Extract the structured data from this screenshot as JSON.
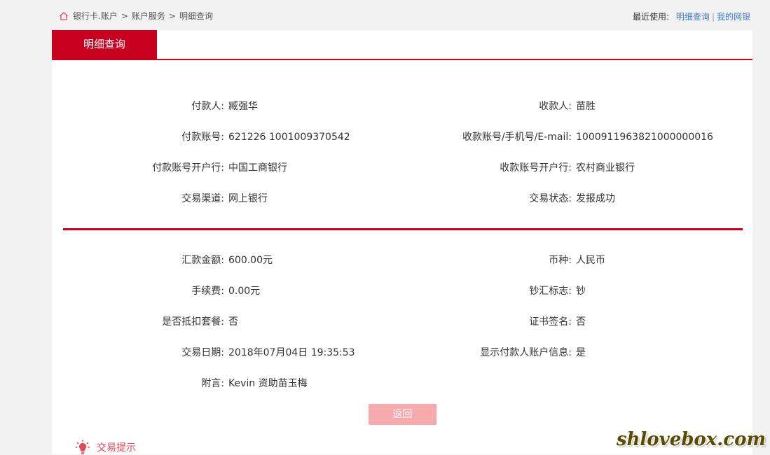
{
  "breadcrumb": {
    "items": [
      "银行卡.账户",
      "账户服务",
      "明细查询"
    ],
    "separator": ">"
  },
  "recent": {
    "label": "最近使用:",
    "links": [
      "明细查询",
      "我的网银"
    ],
    "divider": "|"
  },
  "tab": {
    "title": "明细查询"
  },
  "section1": {
    "left": [
      {
        "label": "付款人:",
        "value": "臧强华"
      },
      {
        "label": "付款账号:",
        "value": "621226 1001009370542"
      },
      {
        "label": "付款账号开户行:",
        "value": "中国工商银行"
      },
      {
        "label": "交易渠道:",
        "value": "网上银行"
      }
    ],
    "right": [
      {
        "label": "收款人:",
        "value": "苗胜"
      },
      {
        "label": "收款账号/手机号/E-mail:",
        "value": "1000911963821000000016"
      },
      {
        "label": "收款账号开户行:",
        "value": "农村商业银行"
      },
      {
        "label": "交易状态:",
        "value": "发报成功"
      }
    ]
  },
  "section2": {
    "left": [
      {
        "label": "汇款金额:",
        "value": "600.00元"
      },
      {
        "label": "手续费:",
        "value": "0.00元"
      },
      {
        "label": "是否抵扣套餐:",
        "value": "否"
      },
      {
        "label": "交易日期:",
        "value": "2018年07月04日 19:35:53"
      },
      {
        "label": "附言:",
        "value": "Kevin 资助苗玉梅"
      }
    ],
    "right": [
      {
        "label": "币种:",
        "value": "人民币"
      },
      {
        "label": "钞汇标志:",
        "value": "钞"
      },
      {
        "label": "证书签名:",
        "value": "否"
      },
      {
        "label": "显示付款人账户信息:",
        "value": "是"
      }
    ]
  },
  "actions": {
    "back_label": "返回"
  },
  "tips": {
    "label": "交易提示"
  },
  "watermark": "shlovebox.com",
  "colors": {
    "brand_red": "#c8001f",
    "link_blue": "#3a7bd5",
    "button_disabled": "#f8a9ad",
    "tip_red": "#e04a57"
  }
}
